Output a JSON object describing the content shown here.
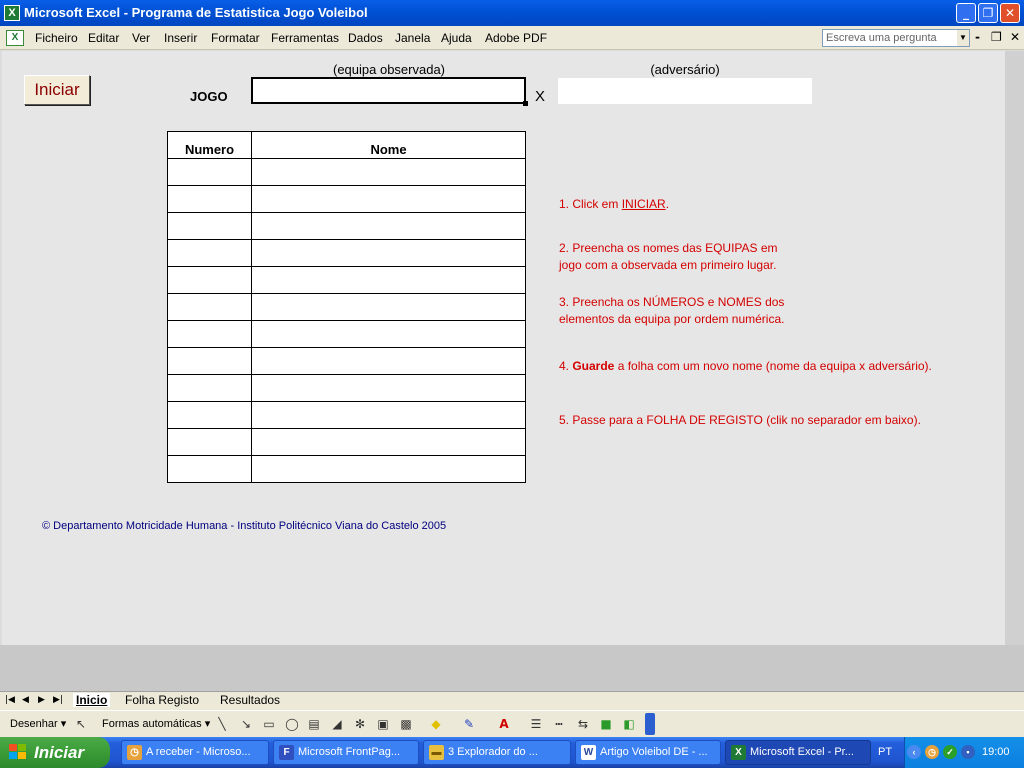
{
  "window": {
    "title": "Microsoft Excel - Programa de Estatistica Jogo Voleibol",
    "app_icon": "excel-icon",
    "controls": [
      "minimize-icon",
      "restore-icon",
      "close-icon"
    ]
  },
  "menu": {
    "items": [
      "Ficheiro",
      "Editar",
      "Ver",
      "Inserir",
      "Formatar",
      "Ferramentas",
      "Dados",
      "Janela",
      "Ajuda",
      "Adobe PDF"
    ],
    "help_placeholder": "Escreva uma pergunta"
  },
  "sheet": {
    "iniciar_button": "Iniciar",
    "jogo_label": "JOGO",
    "observed_label": "(equipa observada)",
    "opponent_label": "(adversário)",
    "observed_value": "",
    "opponent_value": "",
    "versus": "X",
    "roster": {
      "headers": [
        "Numero",
        "Nome"
      ],
      "rows": [
        [
          "",
          ""
        ],
        [
          "",
          ""
        ],
        [
          "",
          ""
        ],
        [
          "",
          ""
        ],
        [
          "",
          ""
        ],
        [
          "",
          ""
        ],
        [
          "",
          ""
        ],
        [
          "",
          ""
        ],
        [
          "",
          ""
        ],
        [
          "",
          ""
        ],
        [
          "",
          ""
        ],
        [
          "",
          ""
        ]
      ]
    },
    "instructions": {
      "step1_prefix": "1. Click em ",
      "step1_link": "INICIAR",
      "step1_suffix": ".",
      "step2_line1": "2. Preencha os nomes das EQUIPAS em",
      "step2_line2": "jogo com a observada em primeiro lugar.",
      "step3_line1": "3. Preencha os NÚMEROS e NOMES dos",
      "step3_line2": "elementos da equipa por ordem numérica.",
      "step4_prefix": "4. ",
      "step4_bold": "Guarde",
      "step4_suffix": " a folha com um novo nome (nome da equipa x adversário).",
      "step5": "5. Passe para a FOLHA DE REGISTO (clik no separador em baixo)."
    },
    "footer": "© Departamento Motricidade Humana - Instituto Politécnico Viana do Castelo 2005"
  },
  "sheet_tabs": {
    "active": "Inicio",
    "tabs": [
      "Inicio",
      "Folha Registo",
      "Resultados"
    ]
  },
  "drawing_toolbar": {
    "draw_label": "Desenhar",
    "autoshapes_label": "Formas automáticas"
  },
  "taskbar": {
    "start_label": "Iniciar",
    "tasks": [
      "A receber - Microso...",
      "Microsoft FrontPag...",
      "3 Explorador do ...",
      "Artigo Voleibol DE - ...",
      "Microsoft Excel - Pr..."
    ],
    "language": "PT",
    "clock": "19:00"
  }
}
